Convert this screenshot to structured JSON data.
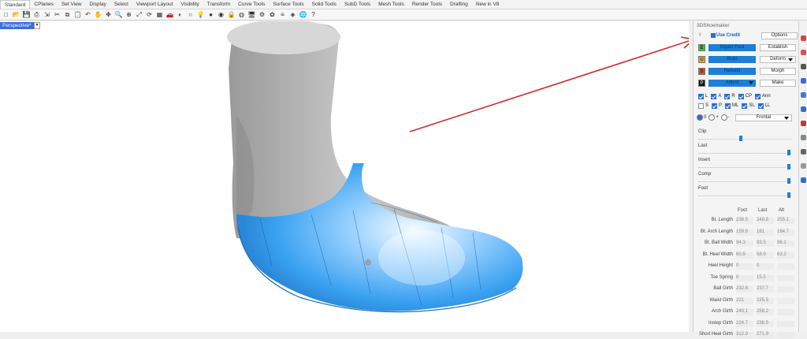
{
  "tabs": [
    "Standard",
    "CPlanes",
    "Set View",
    "Display",
    "Select",
    "Viewport Layout",
    "Visibility",
    "Transform",
    "Curve Tools",
    "Surface Tools",
    "Solid Tools",
    "SubD Tools",
    "Mesh Tools",
    "Render Tools",
    "Drafting",
    "New in V8"
  ],
  "toolbar_icons": [
    "new-file-icon",
    "open-icon",
    "save-icon",
    "print-icon",
    "import-icon",
    "cut-icon",
    "copy-icon",
    "paste-icon",
    "undo-icon",
    "pan-icon",
    "move-icon",
    "zoom-icon",
    "zoom-window-icon",
    "zoom-extents-icon",
    "rotate-view-icon",
    "grid-icon",
    "car-icon",
    "shaded-icon",
    "circle-icon",
    "light-icon",
    "sphere-icon",
    "render-icon",
    "lock-icon",
    "color-wheel-icon",
    "display-icon",
    "gear-icon",
    "flower-icon",
    "layers-icon",
    "material-icon",
    "globe-icon",
    "help-icon"
  ],
  "viewport": {
    "label": "Perspective*",
    "menu": "▾"
  },
  "panel": {
    "title": "3DShoemaker",
    "use_credit": "Use Credit",
    "options": "Options",
    "rows": [
      {
        "key": "E",
        "key_color": "#3bbf3b",
        "action": "Import Foot",
        "side": "Establish",
        "dropdown": false
      },
      {
        "key": "U",
        "key_color": "#f0a020",
        "action": "Build",
        "side": "Deform",
        "dropdown": true
      },
      {
        "key": "S",
        "key_color": "#e04a2a",
        "action": "Rebuild",
        "side": "Morph",
        "dropdown": false
      },
      {
        "key": "P",
        "key_color": "#111111",
        "action": "Adjust",
        "side": "Make",
        "dropdown": false
      }
    ],
    "checks_row1": [
      {
        "label": "L",
        "on": true
      },
      {
        "label": "A",
        "on": true
      },
      {
        "label": "R",
        "on": true
      },
      {
        "label": "CP",
        "on": true
      },
      {
        "label": "Ann",
        "on": true
      }
    ],
    "checks_row2": [
      {
        "label": "S",
        "on": false
      },
      {
        "label": "P",
        "on": true
      },
      {
        "label": "ML",
        "on": true
      },
      {
        "label": "SL",
        "on": true
      },
      {
        "label": "LL",
        "on": true
      }
    ],
    "radios": [
      "0",
      "+",
      "-"
    ],
    "view_select": "Frontal",
    "sliders": [
      {
        "label": "Clip",
        "value": 0.46
      },
      {
        "label": "Last",
        "value": 0.99
      },
      {
        "label": "Insert",
        "value": 0.99
      },
      {
        "label": "Comp",
        "value": 0.99
      },
      {
        "label": "Foot",
        "value": 0.99
      }
    ],
    "measure_headers": [
      "Foot",
      "Last",
      "Alt"
    ],
    "measurements": [
      {
        "label": "Bt. Length",
        "foot": "238.5",
        "last": "249.8",
        "alt": "255.1"
      },
      {
        "label": "Bt. Arch Length",
        "foot": "159.9",
        "last": "161",
        "alt": "164.7"
      },
      {
        "label": "Bt. Ball Width",
        "foot": "94.3",
        "last": "93.5",
        "alt": "96.1"
      },
      {
        "label": "Bt. Heel Width",
        "foot": "60.5",
        "last": "58.9",
        "alt": "63.2"
      },
      {
        "label": "Heel Height",
        "foot": "0",
        "last": "0",
        "alt": ""
      },
      {
        "label": "Toe Spring",
        "foot": "0",
        "last": "15.5",
        "alt": ""
      },
      {
        "label": "Ball Girth",
        "foot": "232.8",
        "last": "237.7",
        "alt": ""
      },
      {
        "label": "Waist Girth",
        "foot": "221",
        "last": "225.5",
        "alt": ""
      },
      {
        "label": "Arch Girth",
        "foot": "249.1",
        "last": "258.2",
        "alt": ""
      },
      {
        "label": "Instep Girth",
        "foot": "224.7",
        "last": "236.5",
        "alt": ""
      },
      {
        "label": "Short Heel Girth",
        "foot": "312.9",
        "last": "271.9",
        "alt": ""
      }
    ]
  },
  "sidebar_icons": [
    "color-icon",
    "redo-icon",
    "monitor-icon",
    "image-icon",
    "camera-icon",
    "sphere-icon",
    "pencil-icon",
    "flag-icon",
    "tree-icon",
    "bulb-icon",
    "info-icon"
  ],
  "colors": {
    "accent": "#1d7fd8",
    "arrow": "#d62828",
    "shoe": "#2e9bf0",
    "foot": "#b8b8b8"
  }
}
